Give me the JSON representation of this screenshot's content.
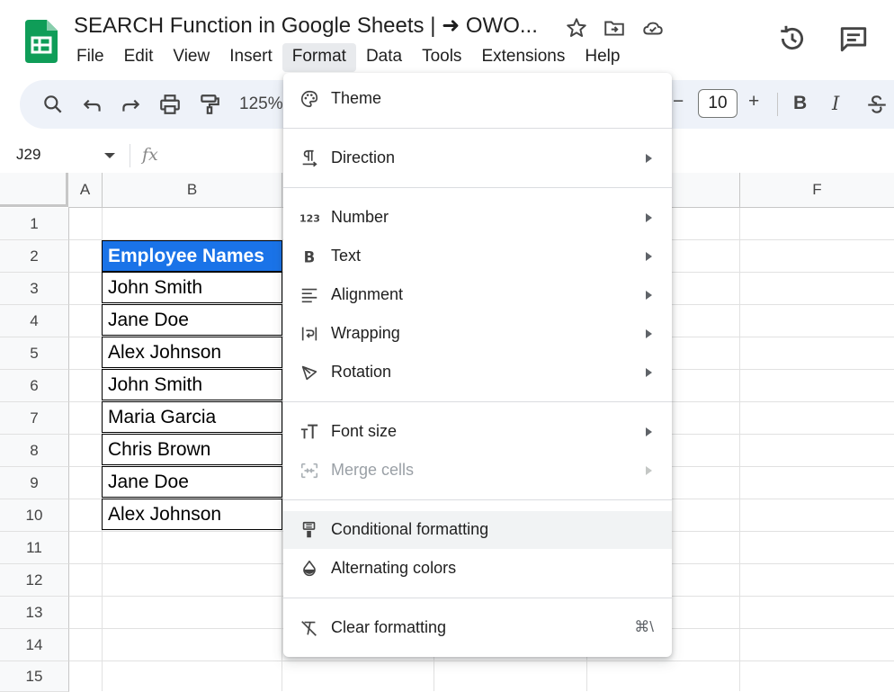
{
  "app": {
    "title": "SEARCH Function in Google Sheets | ➜ OWO...",
    "colors": {
      "sheets_green": "#0f9d58",
      "header_blue": "#1a73e8"
    }
  },
  "menubar": {
    "items": [
      "File",
      "Edit",
      "View",
      "Insert",
      "Format",
      "Data",
      "Tools",
      "Extensions",
      "Help"
    ],
    "active": "Format"
  },
  "toolbar": {
    "zoom": "125%",
    "font_size": "10",
    "minus": "−",
    "plus": "+",
    "bold": "B",
    "italic": "I"
  },
  "formula_bar": {
    "cell_ref": "J29",
    "fx": "fx"
  },
  "grid": {
    "columns": [
      "A",
      "B",
      "F"
    ],
    "rows": [
      "1",
      "2",
      "3",
      "4",
      "5",
      "6",
      "7",
      "8",
      "9",
      "10",
      "11",
      "12",
      "13",
      "14",
      "15"
    ],
    "header_cell": "Employee Names",
    "names": [
      "John Smith",
      "Jane Doe",
      "Alex Johnson",
      "John Smith",
      "Maria Garcia",
      "Chris Brown",
      "Jane Doe",
      "Alex Johnson"
    ]
  },
  "format_menu": {
    "theme": "Theme",
    "direction": "Direction",
    "number": "Number",
    "text": "Text",
    "alignment": "Alignment",
    "wrapping": "Wrapping",
    "rotation": "Rotation",
    "font_size": "Font size",
    "merge_cells": "Merge cells",
    "conditional_formatting": "Conditional formatting",
    "alternating_colors": "Alternating colors",
    "clear_formatting": "Clear formatting",
    "clear_shortcut": "⌘\\"
  }
}
